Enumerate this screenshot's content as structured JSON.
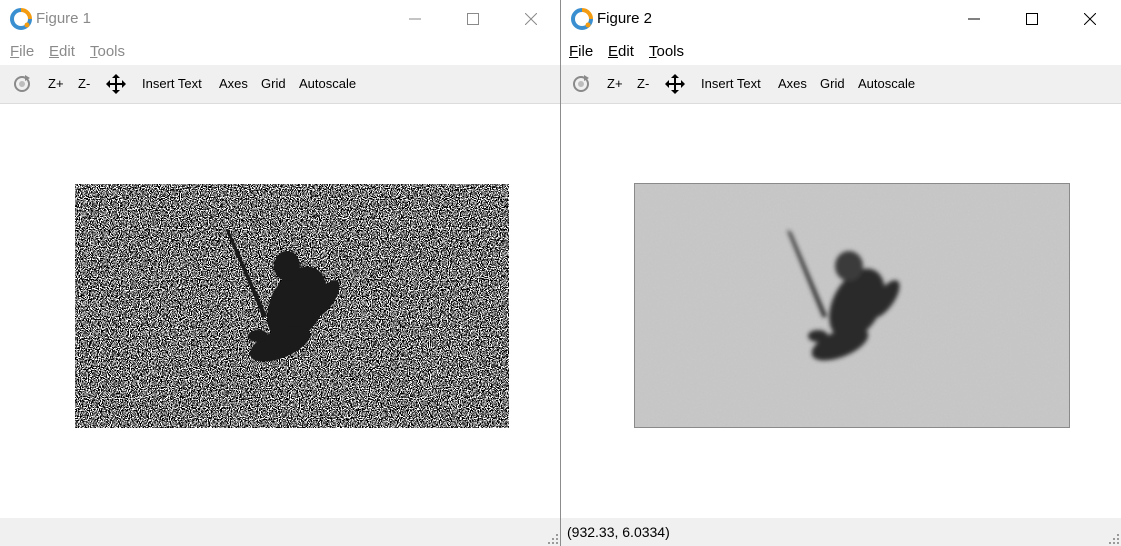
{
  "figure1": {
    "title": "Figure 1",
    "menu": {
      "file_prefix": "F",
      "file_rest": "ile",
      "edit_prefix": "E",
      "edit_rest": "dit",
      "tools_prefix": "T",
      "tools_rest": "ools"
    },
    "toolbar": {
      "zoom_in": "Z+",
      "zoom_out": "Z-",
      "insert_text": "Insert Text",
      "axes": "Axes",
      "grid": "Grid",
      "autoscale": "Autoscale"
    },
    "status": ""
  },
  "figure2": {
    "title": "Figure 2",
    "menu": {
      "file_prefix": "F",
      "file_rest": "ile",
      "edit_prefix": "E",
      "edit_rest": "dit",
      "tools_prefix": "T",
      "tools_rest": "ools"
    },
    "toolbar": {
      "zoom_in": "Z+",
      "zoom_out": "Z-",
      "insert_text": "Insert Text",
      "axes": "Axes",
      "grid": "Grid",
      "autoscale": "Autoscale"
    },
    "status": "(932.33, 6.0334)"
  },
  "icons": [
    "app-logo-icon",
    "minimize-icon",
    "maximize-icon",
    "close-icon",
    "rotate-icon",
    "pan-move-icon",
    "resize-grip-icon"
  ],
  "colors": {
    "toolbar_bg": "#f0f0f0",
    "logo_orange": "#f39c12",
    "logo_blue": "#3a8fd0",
    "inactive_text": "#8a8a8a"
  }
}
